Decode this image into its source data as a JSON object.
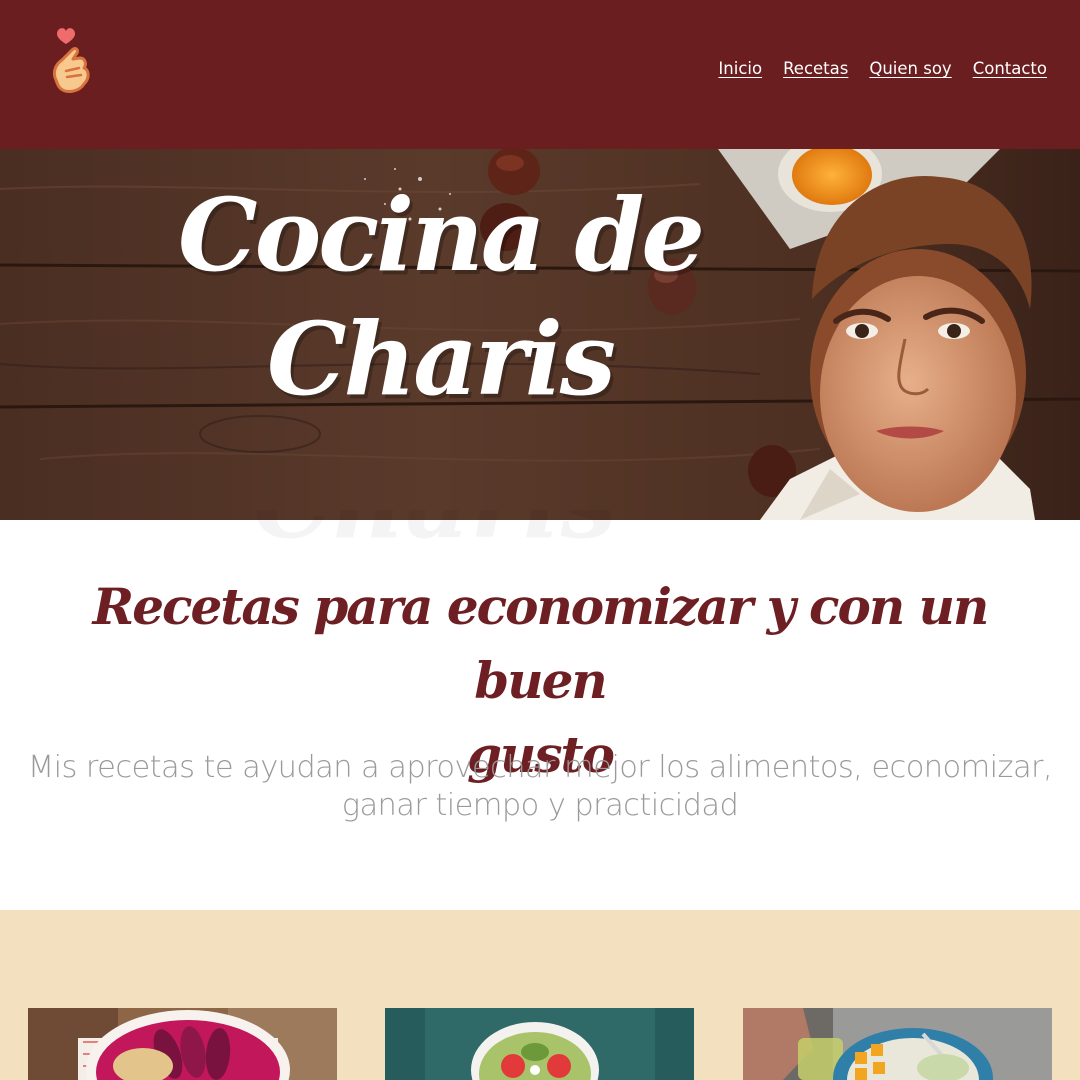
{
  "header": {
    "logo": "finger-heart-logo",
    "nav": [
      "Inicio",
      "Recetas",
      "Quien soy",
      "Contacto"
    ]
  },
  "hero": {
    "title_line1": "Cocina de",
    "title_line2": "Charis",
    "portrait": "chef-portrait-illustration",
    "background": "wooden-table-with-chestnuts"
  },
  "intro": {
    "headline_line1": "Recetas para economizar y con un buen",
    "headline_line2": "gusto",
    "subhead_line1": "Mis recetas te ayudan a aprovechar mejor los alimentos, economizar,",
    "subhead_line2": "ganar tiempo y practicidad"
  },
  "recipes": {
    "cards": [
      {
        "image": "pitaya-coconut-bowl-photo"
      },
      {
        "image": "green-smoothie-bowl-photo"
      },
      {
        "image": "mango-salad-plate-photo"
      }
    ]
  },
  "colors": {
    "header_bg": "#6b1e1f",
    "headline": "#6e1f23",
    "subhead": "#9a9a9a",
    "recipes_bg": "#f2e0bf"
  }
}
